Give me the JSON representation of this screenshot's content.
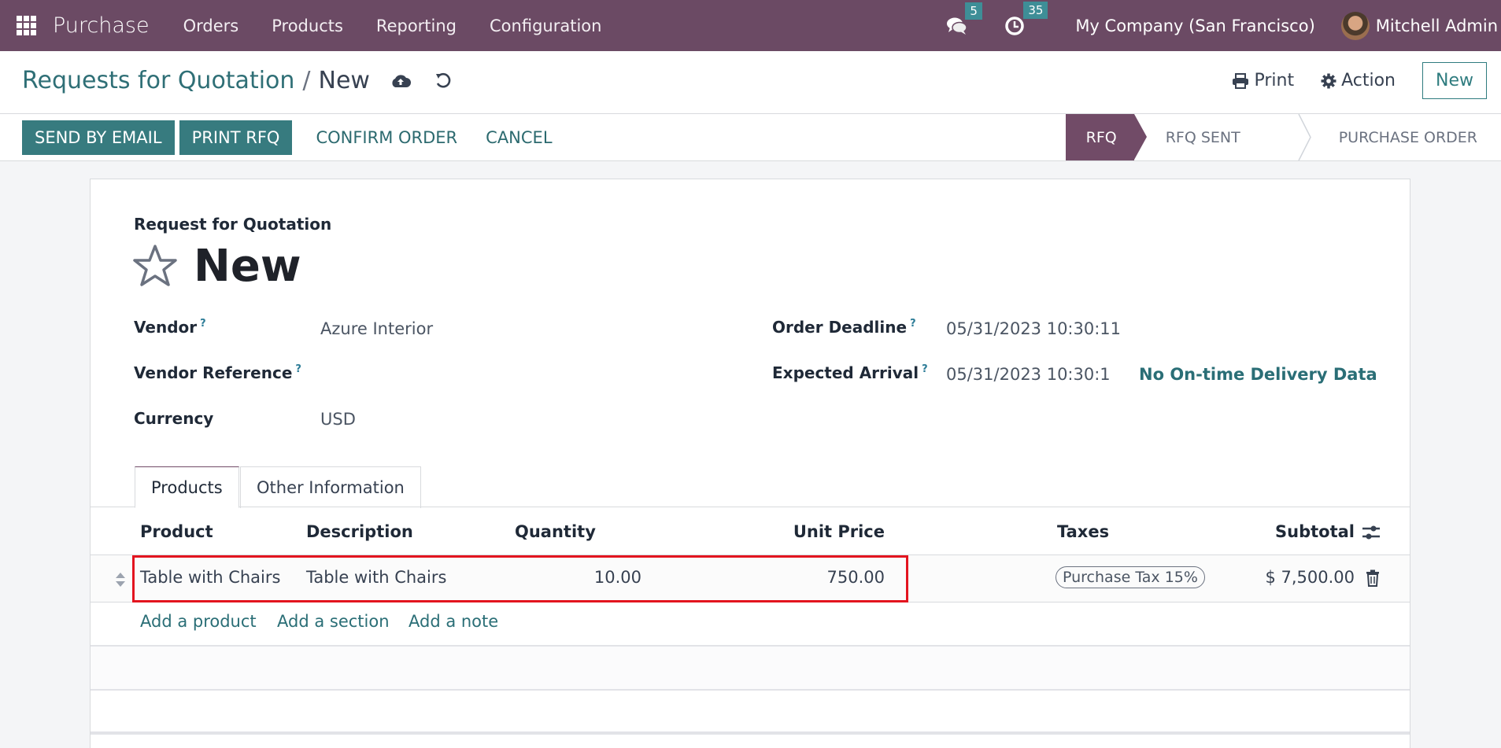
{
  "navbar": {
    "app_name": "Purchase",
    "menu": [
      "Orders",
      "Products",
      "Reporting",
      "Configuration"
    ],
    "messages_count": "5",
    "activities_count": "35",
    "company": "My Company (San Francisco)",
    "user": "Mitchell Admin"
  },
  "control_panel": {
    "breadcrumb_parent": "Requests for Quotation",
    "breadcrumb_separator": "/",
    "breadcrumb_current": "New",
    "print_label": "Print",
    "action_label": "Action",
    "new_label": "New"
  },
  "statusbar": {
    "buttons": [
      "SEND BY EMAIL",
      "PRINT RFQ",
      "CONFIRM ORDER",
      "CANCEL"
    ],
    "stages": [
      "RFQ",
      "RFQ SENT",
      "PURCHASE ORDER"
    ],
    "active_stage": "RFQ"
  },
  "form": {
    "title_label": "Request for Quotation",
    "title": "New",
    "help_marker": "?",
    "fields": {
      "vendor": {
        "label": "Vendor",
        "value": "Azure Interior"
      },
      "vendor_reference": {
        "label": "Vendor Reference",
        "value": ""
      },
      "currency": {
        "label": "Currency",
        "value": "USD"
      },
      "order_deadline": {
        "label": "Order Deadline",
        "value": "05/31/2023 10:30:11"
      },
      "expected_arrival": {
        "label": "Expected Arrival",
        "value": "05/31/2023 10:30:1",
        "extra": "No On-time Delivery Data"
      }
    },
    "tabs": [
      "Products",
      "Other Information"
    ],
    "active_tab": "Products"
  },
  "order_lines": {
    "columns": [
      "Product",
      "Description",
      "Quantity",
      "Unit Price",
      "Taxes",
      "Subtotal"
    ],
    "rows": [
      {
        "product": "Table with Chairs",
        "description": "Table with Chairs",
        "quantity": "10.00",
        "unit_price": "750.00",
        "taxes": "Purchase Tax 15%",
        "subtotal": "$ 7,500.00"
      }
    ],
    "add_links": [
      "Add a product",
      "Add a section",
      "Add a note"
    ]
  },
  "colors": {
    "navbar": "#6b4a64",
    "primary": "#377b7f",
    "link": "#2a6e76",
    "active_stage": "#714b67",
    "highlight_border": "#e3141f"
  }
}
